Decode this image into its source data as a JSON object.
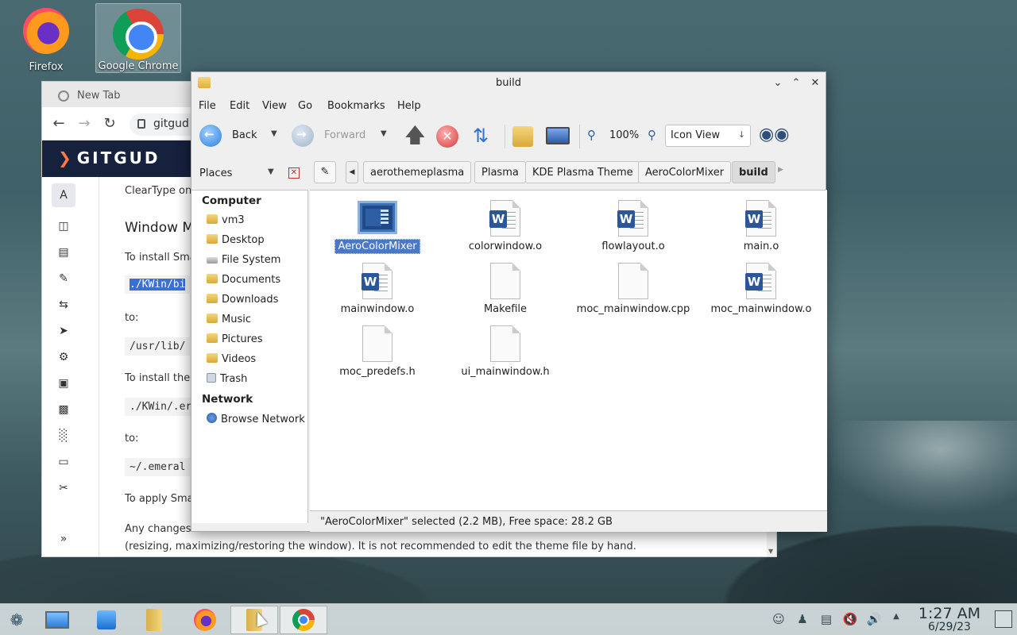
{
  "desktop": {
    "icons": [
      {
        "label": "Firefox",
        "icon": "firefox-icon"
      },
      {
        "label": "Google Chrome",
        "icon": "chrome-icon"
      }
    ]
  },
  "browser": {
    "tab_title": "New Tab",
    "url": "gitgud",
    "site_logo": "GITGUD",
    "sidebar_letter": "A",
    "content": {
      "p1": "ClearType on",
      "heading": "Window M",
      "p2": "To install Sma",
      "code1": "./KWin/bi",
      "to1": "to:",
      "code2": "/usr/lib/",
      "p3": "To install the",
      "code3": "./KWin/.er",
      "to2": "to:",
      "code4": "~/.emeral",
      "p4": "To apply Sma",
      "p5": "Any changes",
      "p6": "(resizing, maximizing/restoring the window). It is not recommended to edit the theme file by hand."
    }
  },
  "filemanager": {
    "title": "build",
    "menu": [
      "File",
      "Edit",
      "View",
      "Go",
      "Bookmarks",
      "Help"
    ],
    "toolbar": {
      "back": "Back",
      "forward": "Forward",
      "zoom": "100%",
      "view_mode": "Icon View"
    },
    "places_label": "Places",
    "breadcrumb": [
      "aerothemeplasma",
      "Plasma",
      "KDE Plasma Theme",
      "AeroColorMixer",
      "build"
    ],
    "sidebar": {
      "computer_heading": "Computer",
      "computer_items": [
        "vm3",
        "Desktop",
        "File System",
        "Documents",
        "Downloads",
        "Music",
        "Pictures",
        "Videos",
        "Trash"
      ],
      "network_heading": "Network",
      "network_items": [
        "Browse Network"
      ]
    },
    "files": [
      {
        "name": "AeroColorMixer",
        "type": "executable",
        "selected": true
      },
      {
        "name": "colorwindow.o",
        "type": "word"
      },
      {
        "name": "flowlayout.o",
        "type": "word"
      },
      {
        "name": "main.o",
        "type": "word"
      },
      {
        "name": "mainwindow.o",
        "type": "word"
      },
      {
        "name": "Makefile",
        "type": "doc"
      },
      {
        "name": "moc_mainwindow.cpp",
        "type": "doc"
      },
      {
        "name": "moc_mainwindow.o",
        "type": "word"
      },
      {
        "name": "moc_predefs.h",
        "type": "doc"
      },
      {
        "name": "ui_mainwindow.h",
        "type": "doc"
      }
    ],
    "status": "\"AeroColorMixer\" selected (2.2 MB), Free space: 28.2 GB"
  },
  "taskbar": {
    "time": "1:27 AM",
    "date": "6/29/23"
  }
}
